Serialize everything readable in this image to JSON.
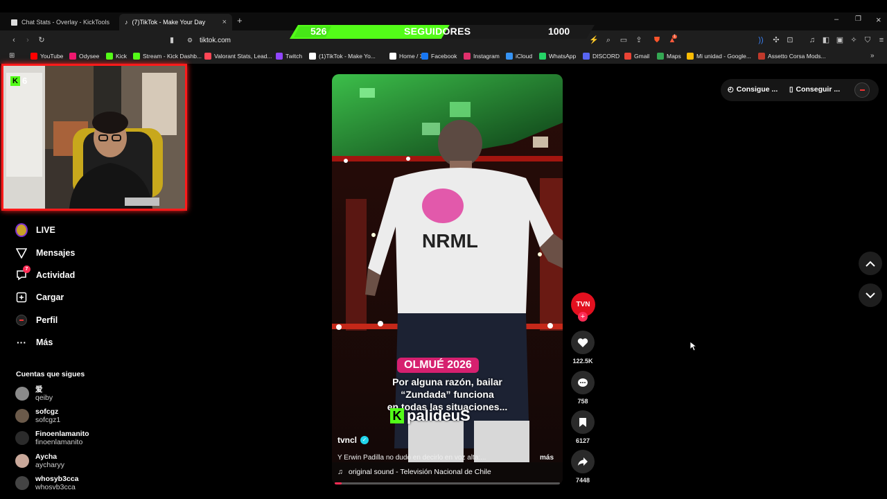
{
  "browser": {
    "tabs": [
      {
        "title": "Chat Stats - Overlay - KickTools"
      },
      {
        "title": "(7)TikTok - Make Your Day"
      }
    ],
    "url": "tiktok.com",
    "bookmarks": [
      {
        "label": "YouTube",
        "color": "#ff0000"
      },
      {
        "label": "Odysee",
        "color": "#ef1970"
      },
      {
        "label": "Kick",
        "color": "#53fc18"
      },
      {
        "label": "Stream - Kick Dashb...",
        "color": "#53fc18"
      },
      {
        "label": "Valorant Stats, Lead...",
        "color": "#ff4655"
      },
      {
        "label": "Twitch",
        "color": "#9146ff"
      },
      {
        "label": "(1)TikTok - Make Yo...",
        "color": "#ffffff"
      },
      {
        "label": "Home / X",
        "color": "#ffffff"
      },
      {
        "label": "Facebook",
        "color": "#1877f2"
      },
      {
        "label": "Instagram",
        "color": "#e1306c"
      },
      {
        "label": "iCloud",
        "color": "#3693f3"
      },
      {
        "label": "WhatsApp",
        "color": "#25d366"
      },
      {
        "label": "DISCORD",
        "color": "#5865f2"
      },
      {
        "label": "Gmail",
        "color": "#ea4335"
      },
      {
        "label": "Maps",
        "color": "#34a853"
      },
      {
        "label": "Mi unidad - Google...",
        "color": "#fbbc04"
      },
      {
        "label": "Assetto Corsa Mods...",
        "color": "#c0392b"
      }
    ],
    "brave_badge": "1"
  },
  "follower_goal": {
    "current": "526",
    "label": "SEGUIDORES",
    "target": "1000",
    "progress": 0.526,
    "color": "#53fc18"
  },
  "webcam": {
    "kick_count": "6",
    "border_color": "#ff1a1a"
  },
  "sidebar": {
    "items": [
      {
        "label": "LIVE",
        "icon": "live-icon"
      },
      {
        "label": "Mensajes",
        "icon": "send-icon"
      },
      {
        "label": "Actividad",
        "icon": "activity-icon",
        "badge": "7"
      },
      {
        "label": "Cargar",
        "icon": "upload-icon"
      },
      {
        "label": "Perfil",
        "icon": "profile-icon"
      },
      {
        "label": "Más",
        "icon": "more-icon"
      }
    ],
    "following_title": "Cuentas que sigues",
    "accounts": [
      {
        "name": "爱",
        "handle": "qeiby"
      },
      {
        "name": "sofcgz",
        "handle": "sofcgz1"
      },
      {
        "name": "Finoenlamanito",
        "handle": "finoenlamanito"
      },
      {
        "name": "Aycha",
        "handle": "aycharyy"
      },
      {
        "name": "whosyb3cca",
        "handle": "whosvb3cca"
      }
    ]
  },
  "top_right": {
    "coins_label": "Consigue ...",
    "app_label": "Conseguir ..."
  },
  "video": {
    "caption_tag": "OLMUÉ 2026",
    "caption_lines": [
      "Por alguna razón, bailar",
      "“Zundada” funciona",
      "en todas las situaciones..."
    ],
    "watermark": "palideuS",
    "author": "tvncl",
    "description": "Y Erwin Padilla no dudó en decirlo en voz alta:...",
    "more_label": "más",
    "sound": "original sound - Televisión Nacional de Chile",
    "progress": 0.03
  },
  "actions": {
    "avatar_text": "TVN",
    "likes": "122.5K",
    "comments": "758",
    "saves": "6127",
    "shares": "7448"
  }
}
